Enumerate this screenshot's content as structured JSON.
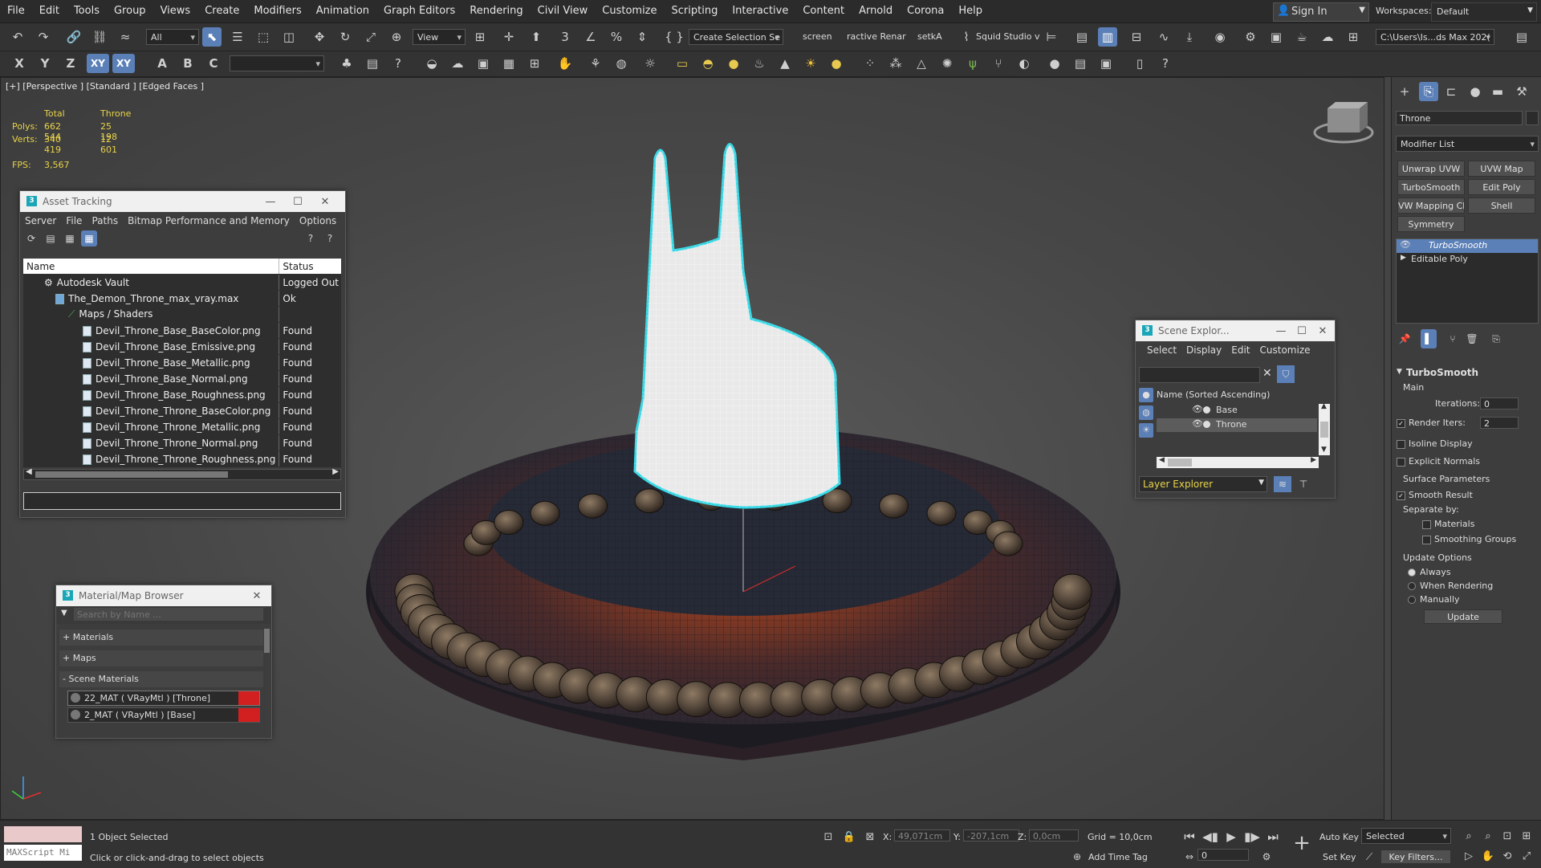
{
  "menubar": {
    "items": [
      "File",
      "Edit",
      "Tools",
      "Group",
      "Views",
      "Create",
      "Modifiers",
      "Animation",
      "Graph Editors",
      "Rendering",
      "Civil View",
      "Customize",
      "Scripting",
      "Interactive",
      "Content",
      "Arnold",
      "Corona",
      "Help"
    ],
    "sign_in": "Sign In",
    "workspaces_label": "Workspaces:",
    "workspace_value": "Default"
  },
  "toolbar": {
    "filter_value": "All",
    "ref_coord": "View",
    "create_selection": "Create Selection Se",
    "tab_screen": "screen",
    "tab_interactive": "ractive Renar",
    "tab_setka": "setkA",
    "squid": "Squid Studio v",
    "project_path": "C:\\Users\\Is...ds Max 202("
  },
  "viewport": {
    "label": "[+] [Perspective ] [Standard ] [Edged Faces ]",
    "stats": {
      "col_total": "Total",
      "col_object": "Throne",
      "polys_label": "Polys:",
      "polys_total": "662 544",
      "polys_object": "25 198",
      "verts_label": "Verts:",
      "verts_total": "340 419",
      "verts_object": "12 601",
      "fps_label": "FPS:",
      "fps_value": "3,567"
    }
  },
  "asset_tracking": {
    "title": "Asset Tracking",
    "menu": [
      "Server",
      "File",
      "Paths",
      "Bitmap Performance and Memory",
      "Options"
    ],
    "col_name": "Name",
    "col_status": "Status",
    "rows": [
      {
        "name": "Autodesk Vault",
        "status": "Logged Out ..."
      },
      {
        "name": "The_Demon_Throne_max_vray.max",
        "status": "Ok"
      },
      {
        "name": "Maps / Shaders",
        "status": ""
      },
      {
        "name": "Devil_Throne_Base_BaseColor.png",
        "status": "Found"
      },
      {
        "name": "Devil_Throne_Base_Emissive.png",
        "status": "Found"
      },
      {
        "name": "Devil_Throne_Base_Metallic.png",
        "status": "Found"
      },
      {
        "name": "Devil_Throne_Base_Normal.png",
        "status": "Found"
      },
      {
        "name": "Devil_Throne_Base_Roughness.png",
        "status": "Found"
      },
      {
        "name": "Devil_Throne_Throne_BaseColor.png",
        "status": "Found"
      },
      {
        "name": "Devil_Throne_Throne_Metallic.png",
        "status": "Found"
      },
      {
        "name": "Devil_Throne_Throne_Normal.png",
        "status": "Found"
      },
      {
        "name": "Devil_Throne_Throne_Roughness.png",
        "status": "Found"
      }
    ]
  },
  "material_browser": {
    "title": "Material/Map Browser",
    "search_placeholder": "Search by Name ...",
    "materials": "+ Materials",
    "maps": "+ Maps",
    "scene_materials": "- Scene Materials",
    "items": [
      "22_MAT ( VRayMtl ) [Throne]",
      "2_MAT ( VRayMtl ) [Base]"
    ]
  },
  "scene_explorer": {
    "title": "Scene Explor...",
    "menu": [
      "Select",
      "Display",
      "Edit",
      "Customize"
    ],
    "column": "Name (Sorted Ascending)",
    "items": [
      "Base",
      "Throne"
    ],
    "layer_explorer": "Layer Explorer"
  },
  "command_panel": {
    "object_name": "Throne",
    "modifier_list": "Modifier List",
    "buttons": [
      "Unwrap UVW",
      "UVW Map",
      "TurboSmooth",
      "Edit Poly",
      "VW Mapping Clea",
      "Shell",
      "Symmetry"
    ],
    "stack": [
      "TurboSmooth",
      "Editable Poly"
    ],
    "rollout_title": "TurboSmooth",
    "main": "Main",
    "iterations_label": "Iterations:",
    "iterations_value": "0",
    "render_iters_label": "Render Iters:",
    "render_iters_value": "2",
    "isoline": "Isoline Display",
    "explicit_normals": "Explicit Normals",
    "surface_params": "Surface Parameters",
    "smooth_result": "Smooth Result",
    "separate_by": "Separate by:",
    "materials": "Materials",
    "smoothing_groups": "Smoothing Groups",
    "update_options": "Update Options",
    "always": "Always",
    "when_rendering": "When Rendering",
    "manually": "Manually",
    "update_btn": "Update"
  },
  "statusbar": {
    "maxscript": "MAXScript Mi",
    "selected": "1 Object Selected",
    "prompt": "Click or click-and-drag to select objects",
    "x_label": "X:",
    "x_value": "49,071cm",
    "y_label": "Y:",
    "y_value": "-207,1cm",
    "z_label": "Z:",
    "z_value": "0,0cm",
    "grid": "Grid = 10,0cm",
    "add_time_tag": "Add Time Tag",
    "auto_key": "Auto Key",
    "selected_dd": "Selected",
    "set_key": "Set Key",
    "key_filters": "Key Filters...",
    "frame": "0"
  }
}
